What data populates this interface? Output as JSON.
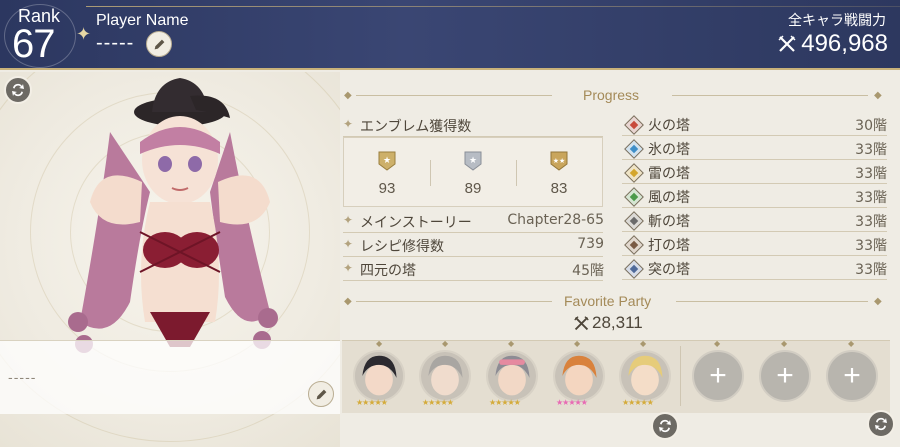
{
  "header": {
    "rank_label": "Rank",
    "rank_value": "67",
    "player_name_label": "Player Name",
    "player_name_value": "-----",
    "total_power_label": "全キャラ戦闘力",
    "total_power_value": "496,968"
  },
  "comment": {
    "text": "-----"
  },
  "progress": {
    "title": "Progress",
    "emblem_label": "エンブレム獲得数",
    "emblems": [
      {
        "tier": "gold",
        "value": "93"
      },
      {
        "tier": "silver",
        "value": "89"
      },
      {
        "tier": "gold-3",
        "value": "83"
      }
    ],
    "main_story_label": "メインストーリー",
    "main_story_value": "Chapter28-65",
    "recipe_label": "レシピ修得数",
    "recipe_value": "739",
    "elements_tower_label": "四元の塔",
    "elements_tower_value": "45階",
    "towers": [
      {
        "name": "火の塔",
        "value": "30階",
        "color": "#c84a3c",
        "icon": "fire-icon"
      },
      {
        "name": "氷の塔",
        "value": "33階",
        "color": "#3f8fc8",
        "icon": "ice-icon"
      },
      {
        "name": "雷の塔",
        "value": "33階",
        "color": "#d4a62c",
        "icon": "thunder-icon"
      },
      {
        "name": "風の塔",
        "value": "33階",
        "color": "#4b9a4a",
        "icon": "wind-icon"
      },
      {
        "name": "斬の塔",
        "value": "33階",
        "color": "#6a6a6a",
        "icon": "slash-icon"
      },
      {
        "name": "打の塔",
        "value": "33階",
        "color": "#7a5a44",
        "icon": "strike-icon"
      },
      {
        "name": "突の塔",
        "value": "33階",
        "color": "#4f6a9a",
        "icon": "pierce-icon"
      }
    ]
  },
  "party": {
    "title": "Favorite Party",
    "power": "28,311",
    "members": [
      {
        "hair": "#2c2a30",
        "skin": "#f3d9c8",
        "stars": "★★★★★",
        "star_color": "#d4ab3a"
      },
      {
        "hair": "#a9a6a2",
        "skin": "#f0dccd",
        "stars": "★★★★★",
        "star_color": "#d4ab3a"
      },
      {
        "hair": "#8d8c94",
        "skin": "#f2d8c6",
        "stars": "★★★★★",
        "star_color": "#d4ab3a"
      },
      {
        "hair": "#d9823d",
        "skin": "#f4d6c0",
        "stars": "★★★★★",
        "star_color": "#e86ab4"
      },
      {
        "hair": "#e6cc7a",
        "skin": "#f4ddc8",
        "stars": "★★★★★",
        "star_color": "#d4ab3a"
      }
    ],
    "add_label": "+"
  },
  "colors": {
    "header_bg": "#2f3a63",
    "gold_accent": "#c9b27a",
    "panel_bg": "#efece4"
  }
}
